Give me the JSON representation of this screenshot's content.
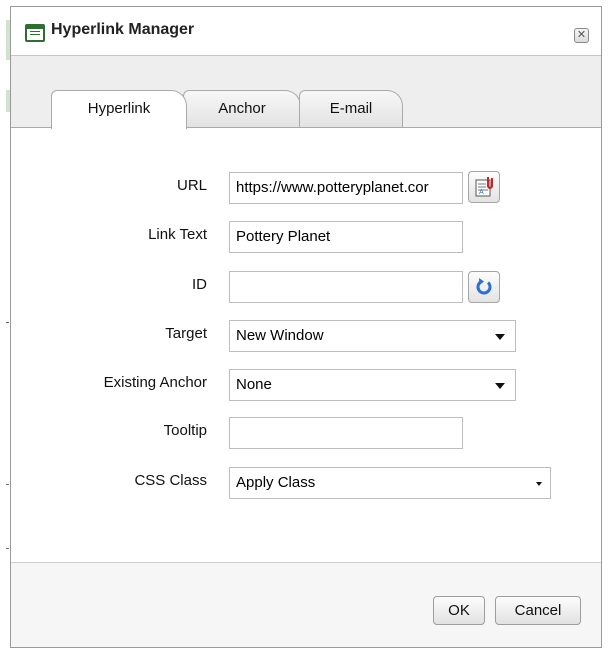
{
  "dialog": {
    "title": "Hyperlink Manager"
  },
  "tabs": [
    {
      "label": "Hyperlink",
      "active": true
    },
    {
      "label": "Anchor",
      "active": false
    },
    {
      "label": "E-mail",
      "active": false
    }
  ],
  "form": {
    "url": {
      "label": "URL",
      "value": "https://www.potteryplanet.cor"
    },
    "link_text": {
      "label": "Link Text",
      "value": "Pottery Planet"
    },
    "id": {
      "label": "ID",
      "value": ""
    },
    "target": {
      "label": "Target",
      "value": "New Window"
    },
    "existing_anchor": {
      "label": "Existing Anchor",
      "value": "None"
    },
    "tooltip": {
      "label": "Tooltip",
      "value": ""
    },
    "css_class": {
      "label": "CSS Class",
      "value": "Apply Class"
    }
  },
  "buttons": {
    "ok": "OK",
    "cancel": "Cancel"
  },
  "icons": {
    "title": "document-icon",
    "close": "close-icon",
    "url_browse": "document-paperclip-icon",
    "id_refresh": "refresh-icon"
  },
  "colors": {
    "title_icon": "#2e6e2e",
    "refresh_icon": "#2f6fd1",
    "clip_icon": "#cc2222"
  }
}
